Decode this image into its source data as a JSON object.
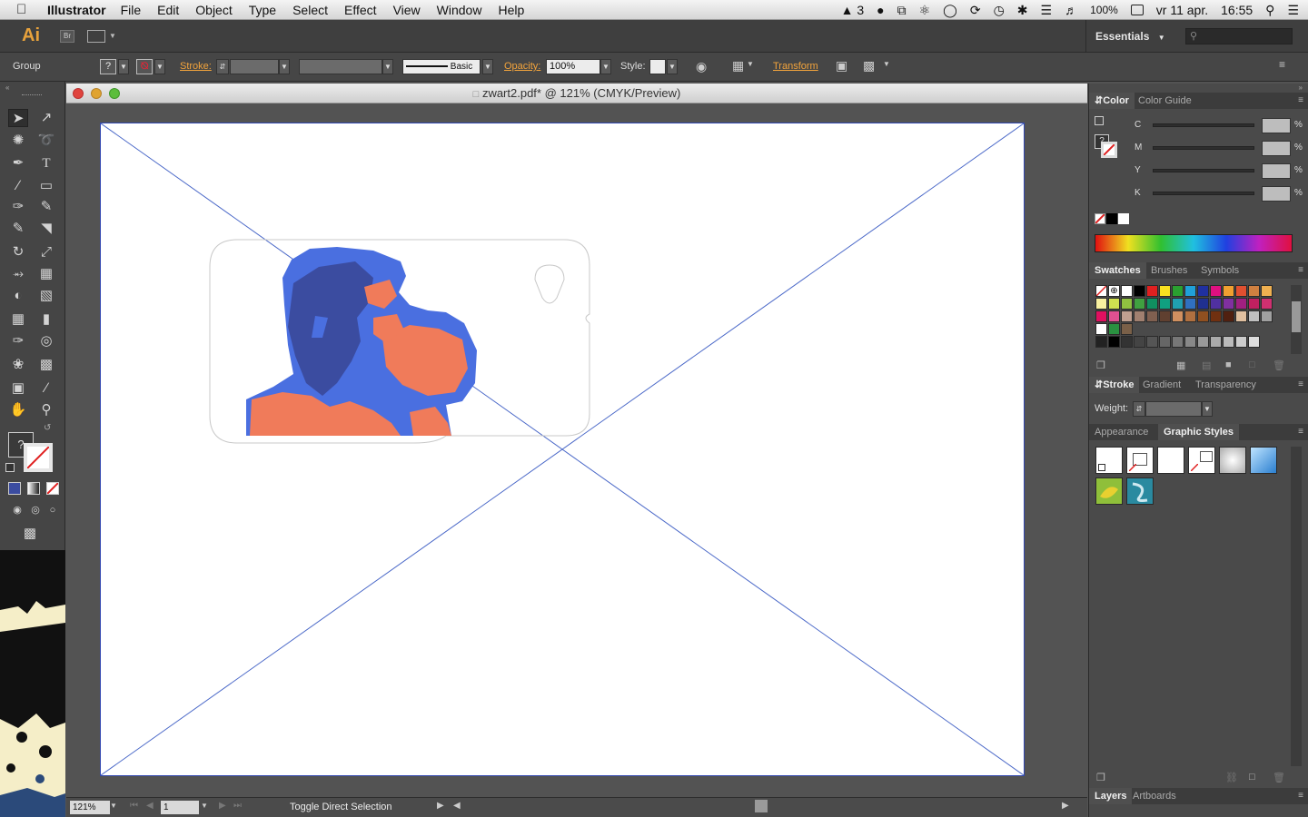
{
  "menubar": {
    "app_name": "Illustrator",
    "menus": [
      "File",
      "Edit",
      "Object",
      "Type",
      "Select",
      "Effect",
      "View",
      "Window",
      "Help"
    ],
    "status": {
      "notification_count": "3",
      "battery": "100%",
      "date": "vr 11 apr.",
      "time": "16:55"
    }
  },
  "appbar": {
    "logo": "Ai",
    "bridge": "Br",
    "workspace": "Essentials"
  },
  "control": {
    "selection": "Group",
    "stroke_label": "Stroke:",
    "brush_label": "Basic",
    "opacity_label": "Opacity:",
    "opacity_value": "100%",
    "style_label": "Style:",
    "transform_label": "Transform"
  },
  "document": {
    "title": "zwart2.pdf* @ 121% (CMYK/Preview)",
    "zoom": "121%",
    "artboard_number": "1",
    "status_text": "Toggle Direct Selection"
  },
  "color_panel": {
    "tabs": [
      "Color",
      "Color Guide"
    ],
    "channels": [
      {
        "label": "C",
        "unit": "%"
      },
      {
        "label": "M",
        "unit": "%"
      },
      {
        "label": "Y",
        "unit": "%"
      },
      {
        "label": "K",
        "unit": "%"
      }
    ]
  },
  "swatches_panel": {
    "tabs": [
      "Swatches",
      "Brushes",
      "Symbols"
    ]
  },
  "stroke_panel": {
    "tabs": [
      "Stroke",
      "Gradient",
      "Transparency"
    ],
    "weight_label": "Weight:"
  },
  "appearance_panel": {
    "tabs": [
      "Appearance",
      "Graphic Styles"
    ]
  },
  "layers_panel": {
    "tabs": [
      "Layers",
      "Artboards"
    ]
  },
  "colors": {
    "art_blue": "#4a6fe0",
    "art_dark_blue": "#3b4ca0",
    "art_orange": "#f07b5a",
    "ai_orange": "#e8a23c"
  }
}
